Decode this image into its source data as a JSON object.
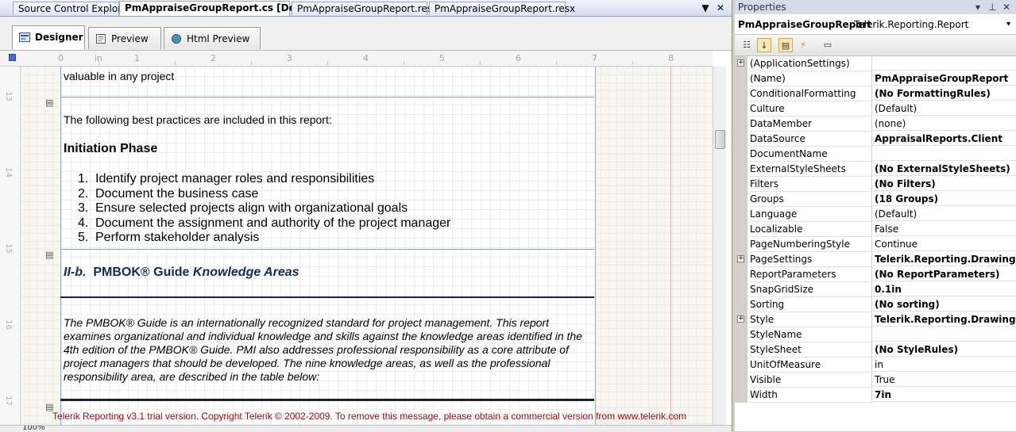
{
  "doc_tabs": [
    {
      "label": "Source Control Explorer",
      "active": false
    },
    {
      "label": "PmAppraiseGroupReport.cs [Design]",
      "active": true
    },
    {
      "label": "PmAppraiseGroupReport.resx",
      "active": false
    },
    {
      "label": "PmAppraiseGroupReport.resx",
      "active": false
    }
  ],
  "window_buttons": {
    "dropdown": "▼",
    "close": "✕"
  },
  "view_tabs": [
    {
      "label": "Designer",
      "active": true
    },
    {
      "label": "Preview",
      "active": false
    },
    {
      "label": "Html Preview",
      "active": false
    }
  ],
  "ruler": {
    "unit": "in",
    "marks": [
      "0",
      "1",
      "2",
      "3",
      "4",
      "5",
      "6",
      "7",
      "8"
    ]
  },
  "line_numbers": [
    "13",
    "14",
    "15",
    "16",
    "17"
  ],
  "report": {
    "top_fragment": "valuable in any project",
    "intro": "The following best practices are included in this report:",
    "section_heading": "Initiation Phase",
    "list_items": [
      {
        "n": "1.",
        "text": "Identify project manager roles and responsibilities"
      },
      {
        "n": "2.",
        "text": "Document the business case"
      },
      {
        "n": "3.",
        "text": "Ensure selected projects align with organizational goals"
      },
      {
        "n": "4.",
        "text": "Document the assignment and authority of the project manager"
      },
      {
        "n": "5.",
        "text": "Perform stakeholder analysis"
      }
    ],
    "heading2_prefix": "II-b.",
    "heading2_mid": "PMBOK® Guide",
    "heading2_suffix": "Knowledge Areas",
    "paragraph": "The PMBOK® Guide is an internationally recognized standard for project management. This report examines organizational and individual knowledge and skills against the knowledge areas identified in the 4th edition of the PMBOK® Guide. PMI also addresses professional responsibility as a core attribute of project managers that should be developed. The nine knowledge areas, as well as the professional responsibility area, are described in the table below:",
    "trial_notice": "Telerik Reporting v3.1 trial version. Copyright Telerik © 2002-2009. To remove this message, please obtain a commercial version from www.telerik.com"
  },
  "zoom": "100%",
  "properties": {
    "title": "Properties",
    "object_name": "PmAppraiseGroupReport",
    "object_type": "Telerik.Reporting.Report",
    "rows": [
      {
        "name": "(ApplicationSettings)",
        "value": "",
        "bold": false,
        "expand": true
      },
      {
        "name": "(Name)",
        "value": "PmAppraiseGroupReport",
        "bold": true,
        "expand": false
      },
      {
        "name": "ConditionalFormatting",
        "value": "(No FormattingRules)",
        "bold": true,
        "expand": false
      },
      {
        "name": "Culture",
        "value": "(Default)",
        "bold": false,
        "expand": false
      },
      {
        "name": "DataMember",
        "value": "(none)",
        "bold": false,
        "expand": false
      },
      {
        "name": "DataSource",
        "value": "AppraisalReports.Client",
        "bold": true,
        "expand": false
      },
      {
        "name": "DocumentName",
        "value": "",
        "bold": false,
        "expand": false
      },
      {
        "name": "ExternalStyleSheets",
        "value": "(No ExternalStyleSheets)",
        "bold": true,
        "expand": false
      },
      {
        "name": "Filters",
        "value": "(No Filters)",
        "bold": true,
        "expand": false
      },
      {
        "name": "Groups",
        "value": "(18 Groups)",
        "bold": true,
        "expand": false
      },
      {
        "name": "Language",
        "value": "(Default)",
        "bold": false,
        "expand": false
      },
      {
        "name": "Localizable",
        "value": "False",
        "bold": false,
        "expand": false
      },
      {
        "name": "PageNumberingStyle",
        "value": "Continue",
        "bold": false,
        "expand": false
      },
      {
        "name": "PageSettings",
        "value": "Telerik.Reporting.Drawing.PageSettings",
        "bold": true,
        "expand": true
      },
      {
        "name": "ReportParameters",
        "value": "(No ReportParameters)",
        "bold": true,
        "expand": false
      },
      {
        "name": "SnapGridSize",
        "value": "0.1in",
        "bold": true,
        "expand": false
      },
      {
        "name": "Sorting",
        "value": "(No sorting)",
        "bold": true,
        "expand": false
      },
      {
        "name": "Style",
        "value": "Telerik.Reporting.Drawing.Style",
        "bold": true,
        "expand": true
      },
      {
        "name": "StyleName",
        "value": "",
        "bold": false,
        "expand": false
      },
      {
        "name": "StyleSheet",
        "value": "(No StyleRules)",
        "bold": true,
        "expand": false
      },
      {
        "name": "UnitOfMeasure",
        "value": "in",
        "bold": false,
        "expand": false
      },
      {
        "name": "Visible",
        "value": "True",
        "bold": false,
        "expand": false
      },
      {
        "name": "Width",
        "value": "7in",
        "bold": true,
        "expand": false
      }
    ]
  }
}
